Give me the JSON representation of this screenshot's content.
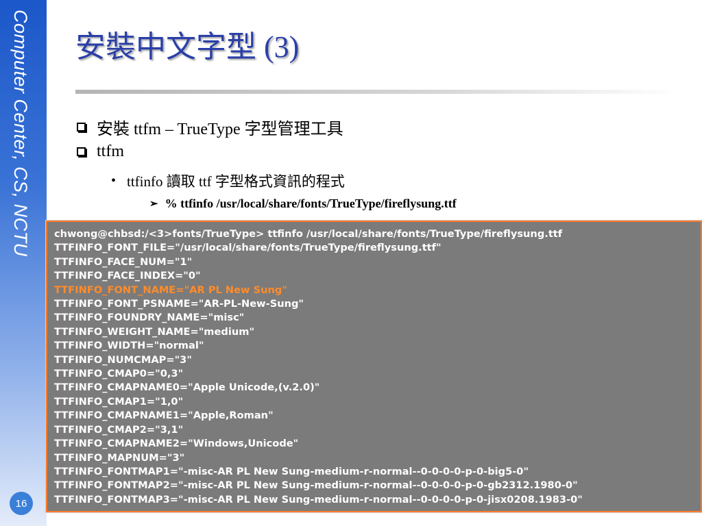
{
  "sidebar": {
    "text": "Computer Center, CS, NCTU",
    "page_number": "16"
  },
  "slide": {
    "title": "安裝中文字型 (3)",
    "bullets": [
      {
        "text": "安裝 ttfm – TrueType 字型管理工具"
      },
      {
        "text": "ttfm"
      }
    ],
    "sub_bullet": {
      "text": "ttfinfo 讀取 ttf 字型格式資訊的程式"
    },
    "command": {
      "text": "% ttfinfo /usr/local/share/fonts/TrueType/fireflysung.ttf"
    }
  },
  "terminal": {
    "highlight_color": "#ff8c2a",
    "lines": [
      "chwong@chbsd:/<3>fonts/TrueType> ttfinfo /usr/local/share/fonts/TrueType/fireflysung.ttf",
      "TTFINFO_FONT_FILE=\"/usr/local/share/fonts/TrueType/fireflysung.ttf\"",
      "TTFINFO_FACE_NUM=\"1\"",
      "TTFINFO_FACE_INDEX=\"0\"",
      "TTFINFO_FONT_NAME=\"AR PL New Sung\"",
      "TTFINFO_FONT_PSNAME=\"AR-PL-New-Sung\"",
      "TTFINFO_FOUNDRY_NAME=\"misc\"",
      "TTFINFO_WEIGHT_NAME=\"medium\"",
      "TTFINFO_WIDTH=\"normal\"",
      "TTFINFO_NUMCMAP=\"3\"",
      "TTFINFO_CMAP0=\"0,3\"",
      "TTFINFO_CMAPNAME0=\"Apple Unicode,(v.2.0)\"",
      "TTFINFO_CMAP1=\"1,0\"",
      "TTFINFO_CMAPNAME1=\"Apple,Roman\"",
      "TTFINFO_CMAP2=\"3,1\"",
      "TTFINFO_CMAPNAME2=\"Windows,Unicode\"",
      "TTFINFO_MAPNUM=\"3\"",
      "TTFINFO_FONTMAP1=\"-misc-AR PL New Sung-medium-r-normal--0-0-0-0-p-0-big5-0\"",
      "TTFINFO_FONTMAP2=\"-misc-AR PL New Sung-medium-r-normal--0-0-0-0-p-0-gb2312.1980-0\"",
      "TTFINFO_FONTMAP3=\"-misc-AR PL New Sung-medium-r-normal--0-0-0-0-p-0-jisx0208.1983-0\""
    ]
  }
}
